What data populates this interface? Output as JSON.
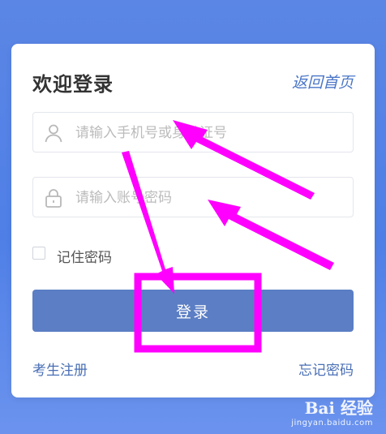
{
  "login": {
    "title": "欢迎登录",
    "back_home": "返回首页",
    "phone_placeholder": "请输入手机号或身份证号",
    "password_placeholder": "请输入账号密码",
    "remember_label": "记住密码",
    "login_button": "登录",
    "register_link": "考生注册",
    "forgot_link": "忘记密码"
  },
  "watermark": {
    "brand": "Bai 经验",
    "url": "jingyan.baidu.com"
  },
  "colors": {
    "background": "#5b86e5",
    "accent": "#5b7ec4",
    "annotation": "#ff00ff",
    "link": "#4a6fb5"
  },
  "icons": [
    "user-icon",
    "lock-icon"
  ]
}
